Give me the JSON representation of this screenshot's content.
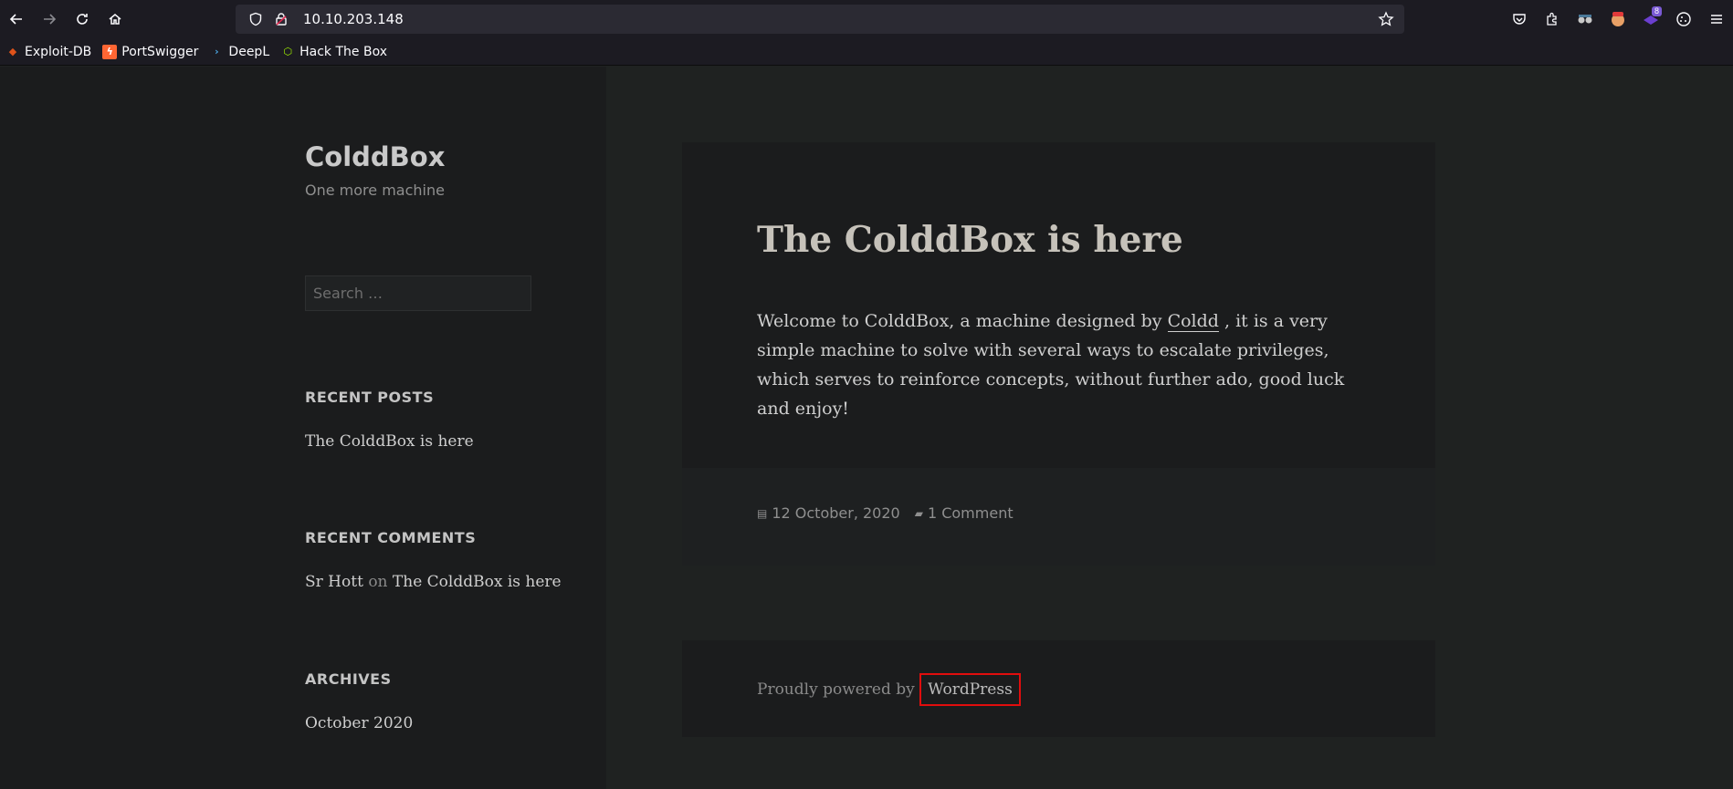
{
  "browser": {
    "url": "10.10.203.148",
    "ext_badge": "8",
    "bookmarks": [
      {
        "label": "Exploit-DB",
        "color": "#e0531a"
      },
      {
        "label": "PortSwigger",
        "color": "#ff6633"
      },
      {
        "label": "DeepL",
        "color": "#4aa3df"
      },
      {
        "label": "Hack The Box",
        "color": "#9fef00"
      }
    ]
  },
  "site": {
    "title": "ColddBox",
    "tagline": "One more machine",
    "search_placeholder": "Search …"
  },
  "widgets": {
    "recent_posts_title": "RECENT POSTS",
    "recent_post_1": "The ColddBox is here",
    "recent_comments_title": "RECENT COMMENTS",
    "comment_author": "Sr Hott",
    "comment_on": "on",
    "comment_post": "The ColddBox is here",
    "archives_title": "ARCHIVES",
    "archive_1": "October 2020"
  },
  "post": {
    "title": "The ColddBox is here",
    "content_before": "Welcome to ColddBox, a machine designed by ",
    "content_link": "Coldd",
    "content_after": " , it is a very simple machine to solve with several ways to escalate privileges, which serves to reinforce concepts, without further ado, good luck and enjoy!",
    "date": "12 October, 2020",
    "comments": "1 Comment"
  },
  "footer": {
    "powered_by": "Proudly powered by ",
    "wp_link": "WordPress",
    "highlight_color": "#e10d0d"
  }
}
